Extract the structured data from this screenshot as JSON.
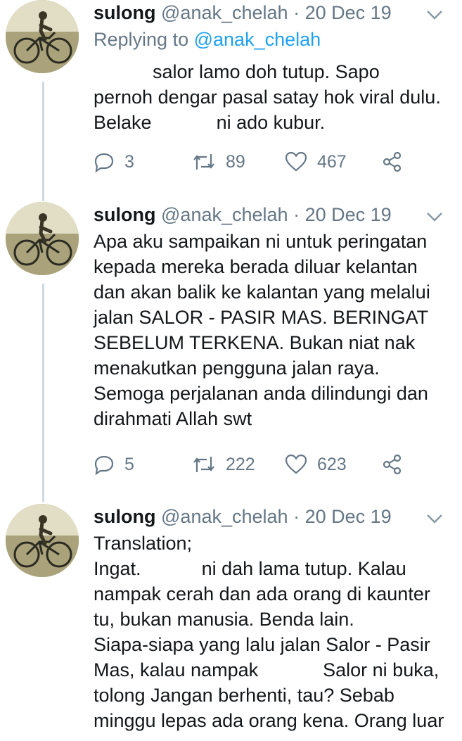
{
  "tweets": [
    {
      "name": "sulong",
      "handle": "@anak_chelah",
      "separator": "·",
      "date": "20 Dec 19",
      "replying_prefix": "Replying to",
      "replying_to": "@anak_chelah",
      "lines": [
        "salor lamo doh tutup. Sapo",
        "pernoh dengar pasal satay hok viral dulu.",
        "Belake",
        "ni ado kubur."
      ],
      "replies": "3",
      "retweets": "89",
      "likes": "467"
    },
    {
      "name": "sulong",
      "handle": "@anak_chelah",
      "separator": "·",
      "date": "20 Dec 19",
      "lines": [
        "Apa aku sampaikan ni untuk peringatan",
        "kepada mereka berada diluar kelantan",
        "dan akan balik ke kalantan yang melalui",
        "jalan SALOR - PASIR MAS. BERINGAT",
        "SEBELUM TERKENA. Bukan niat nak",
        "menakutkan pengguna jalan raya.",
        "Semoga perjalanan anda dilindungi dan",
        "dirahmati Allah swt"
      ],
      "replies": "5",
      "retweets": "222",
      "likes": "623"
    },
    {
      "name": "sulong",
      "handle": "@anak_chelah",
      "separator": "·",
      "date": "20 Dec 19",
      "lines": [
        "Translation;",
        "Ingat.",
        "ni dah lama tutup. Kalau",
        "nampak cerah dan ada orang di kaunter",
        "tu, bukan manusia. Benda lain.",
        "Siapa-siapa yang lalu jalan Salor - Pasir",
        "Mas, kalau nampak",
        "Salor ni buka,",
        "tolong Jangan berhenti, tau? Sebab",
        "minggu lepas ada orang kena. Orang luar"
      ]
    }
  ],
  "icons": {
    "reply": "reply-icon",
    "retweet": "retweet-icon",
    "like": "heart-icon",
    "share": "share-icon",
    "menu": "chevron-down-icon"
  },
  "colors": {
    "text": "#14171a",
    "muted": "#657786",
    "link": "#1da1f2",
    "thread_line": "#cfd9de"
  }
}
